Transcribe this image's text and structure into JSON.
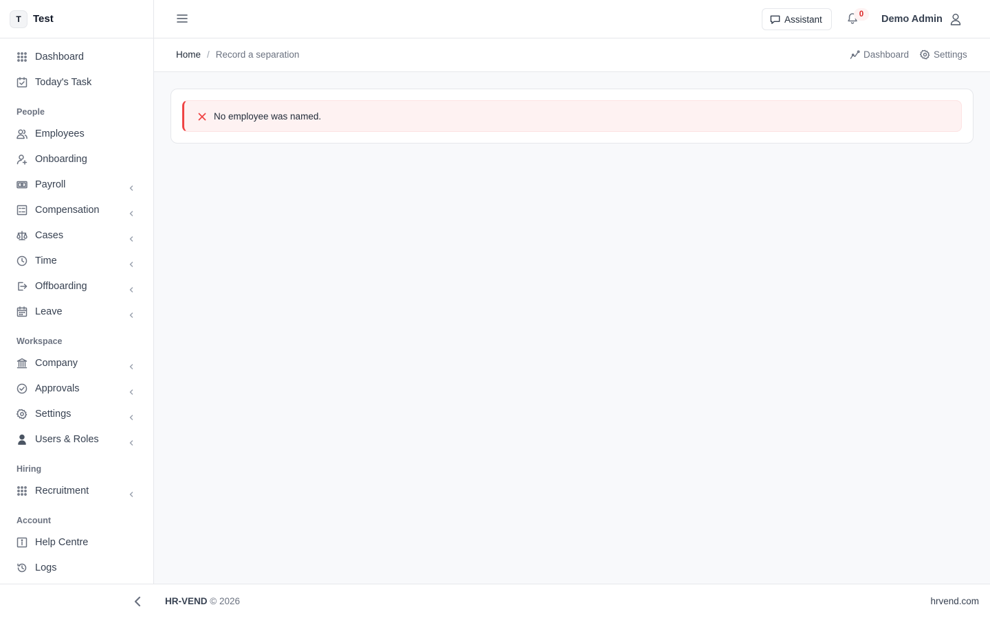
{
  "brand": {
    "initial": "T",
    "name": "Test"
  },
  "sidebar": {
    "top_items": [
      {
        "label": "Dashboard",
        "icon": "grid-dots-icon"
      },
      {
        "label": "Today's Task",
        "icon": "calendar-check-icon"
      }
    ],
    "sections": [
      {
        "title": "People",
        "items": [
          {
            "label": "Employees",
            "icon": "users-icon",
            "chevron": false
          },
          {
            "label": "Onboarding",
            "icon": "user-plus-icon",
            "chevron": false
          },
          {
            "label": "Payroll",
            "icon": "banknote-icon",
            "chevron": true
          },
          {
            "label": "Compensation",
            "icon": "list-icon",
            "chevron": true
          },
          {
            "label": "Cases",
            "icon": "scale-icon",
            "chevron": true
          },
          {
            "label": "Time",
            "icon": "clock-icon",
            "chevron": true
          },
          {
            "label": "Offboarding",
            "icon": "logout-icon",
            "chevron": true
          },
          {
            "label": "Leave",
            "icon": "calendar-icon",
            "chevron": true
          }
        ]
      },
      {
        "title": "Workspace",
        "items": [
          {
            "label": "Company",
            "icon": "building-icon",
            "chevron": true
          },
          {
            "label": "Approvals",
            "icon": "check-circle-icon",
            "chevron": true
          },
          {
            "label": "Settings",
            "icon": "gear-icon",
            "chevron": true
          },
          {
            "label": "Users & Roles",
            "icon": "user-shield-icon",
            "chevron": true
          }
        ]
      },
      {
        "title": "Hiring",
        "items": [
          {
            "label": "Recruitment",
            "icon": "grid-dots-icon",
            "chevron": true
          }
        ]
      },
      {
        "title": "Account",
        "items": [
          {
            "label": "Help Centre",
            "icon": "info-icon",
            "chevron": false
          },
          {
            "label": "Logs",
            "icon": "history-icon",
            "chevron": false
          }
        ]
      }
    ]
  },
  "header": {
    "assistant_label": "Assistant",
    "notification_count": "0",
    "user_name": "Demo Admin"
  },
  "breadcrumb": {
    "home": "Home",
    "separator": "/",
    "current": "Record a separation"
  },
  "quick_links": {
    "dashboard": "Dashboard",
    "settings": "Settings"
  },
  "alert": {
    "message": "No employee was named.",
    "color": "#ef4444"
  },
  "footer": {
    "brand": "HR-VEND",
    "copyright": "© 2026",
    "site": "hrvend.com"
  }
}
